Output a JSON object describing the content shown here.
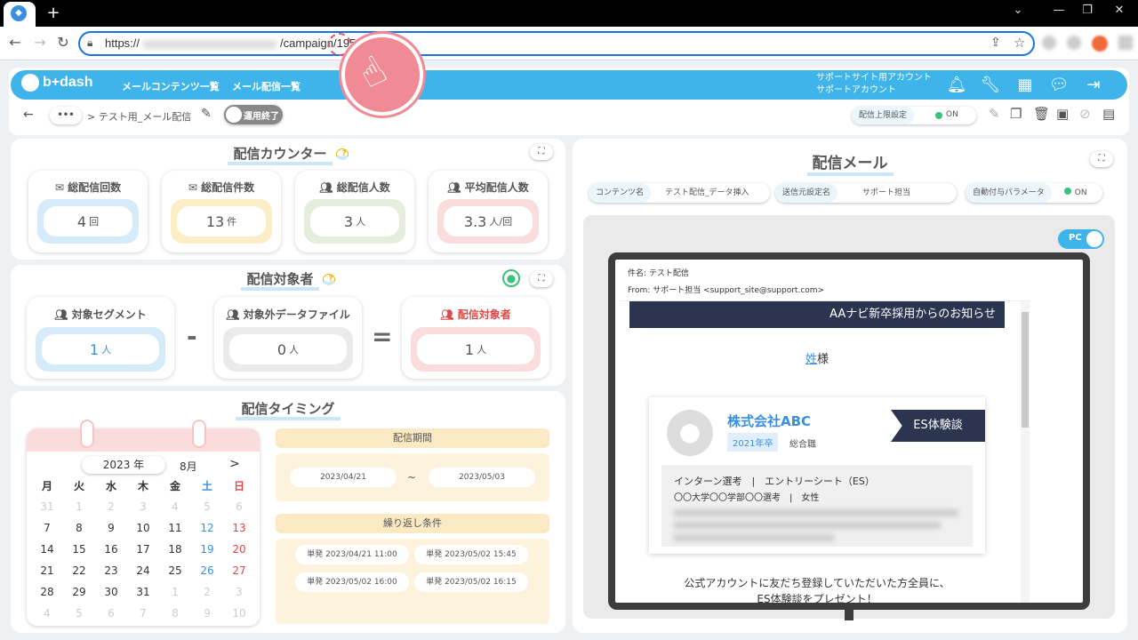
{
  "browser": {
    "url_prefix": "https://",
    "url_suffix": "/campaign/195/1"
  },
  "header": {
    "logo": "b+dash",
    "nav": [
      "メールコンテンツ一覧",
      "メール配信一覧"
    ],
    "account_line1": "サポートサイト用アカウント",
    "account_line2": "サポートアカウント"
  },
  "subbar": {
    "breadcrumb_more": "•••",
    "breadcrumb": "> テスト用_メール配信",
    "toggle_label": "運用終了",
    "limit_label": "配信上限設定",
    "limit_value": "ON"
  },
  "counter": {
    "title": "配信カウンター",
    "cards": [
      {
        "label": "総配信回数",
        "value": "4",
        "unit": "回",
        "color": "#d6ebfa"
      },
      {
        "label": "総配信件数",
        "value": "13",
        "unit": "件",
        "color": "#fbeec7"
      },
      {
        "label": "総配信人数",
        "value": "3",
        "unit": "人",
        "color": "#e7eddc"
      },
      {
        "label": "平均配信人数",
        "value": "3.3",
        "unit": "人/回",
        "color": "#fbdcdc"
      }
    ]
  },
  "target": {
    "title": "配信対象者",
    "segment_label": "対象セグメント",
    "segment_value": "1",
    "segment_unit": "人",
    "exclude_label": "対象外データファイル",
    "exclude_value": "0",
    "exclude_unit": "人",
    "result_label": "配信対象者",
    "result_value": "1",
    "result_unit": "人",
    "minus": "-",
    "equals": "="
  },
  "timing": {
    "title": "配信タイミング",
    "year": "2023",
    "year_unit": "年",
    "month": "8月",
    "next": ">",
    "weekdays": [
      "月",
      "火",
      "水",
      "木",
      "金",
      "土",
      "日"
    ],
    "weeks": [
      [
        "31",
        "1",
        "2",
        "3",
        "4",
        "5",
        "6"
      ],
      [
        "7",
        "8",
        "9",
        "10",
        "11",
        "12",
        "13"
      ],
      [
        "14",
        "15",
        "16",
        "17",
        "18",
        "19",
        "20"
      ],
      [
        "21",
        "22",
        "23",
        "24",
        "25",
        "26",
        "27"
      ],
      [
        "28",
        "29",
        "30",
        "31",
        "1",
        "2",
        "3"
      ],
      [
        "4",
        "5",
        "6",
        "7",
        "8",
        "9",
        "10"
      ]
    ],
    "period_label": "配信期間",
    "period_start": "2023/04/21",
    "period_sep": "~",
    "period_end": "2023/05/03",
    "repeat_label": "繰り返し条件",
    "repeats": [
      "単発 2023/04/21 11:00",
      "単発 2023/05/02 15:45",
      "単発 2023/05/02 16:00",
      "単発 2023/05/02 16:15"
    ]
  },
  "mail": {
    "title": "配信メール",
    "content_key": "コンテンツ名",
    "content_val": "テスト配信_データ挿入",
    "sender_key": "送信元設定名",
    "sender_val": "サポート担当",
    "param_key": "自動付与パラメータ",
    "param_val": "ON",
    "pc_label": "PC",
    "subject": "件名: テスト配信",
    "from": "From: サポート担当 <support_site@support.com>",
    "banner": "AAナビ新卒採用からのお知らせ",
    "greeting_name": "姓",
    "greeting_suffix": "様",
    "company": "株式会社ABC",
    "year_badge": "2021年卒",
    "job": "総合職",
    "ribbon": "ES体験談",
    "info1": "インターン選考　|　エントリーシート（ES）",
    "info2": "〇〇大学〇〇学部〇〇選考　|　女性",
    "footer1": "公式アカウントに友だち登録していただいた方全員に、",
    "footer2": "ES体験談をプレゼント！"
  }
}
